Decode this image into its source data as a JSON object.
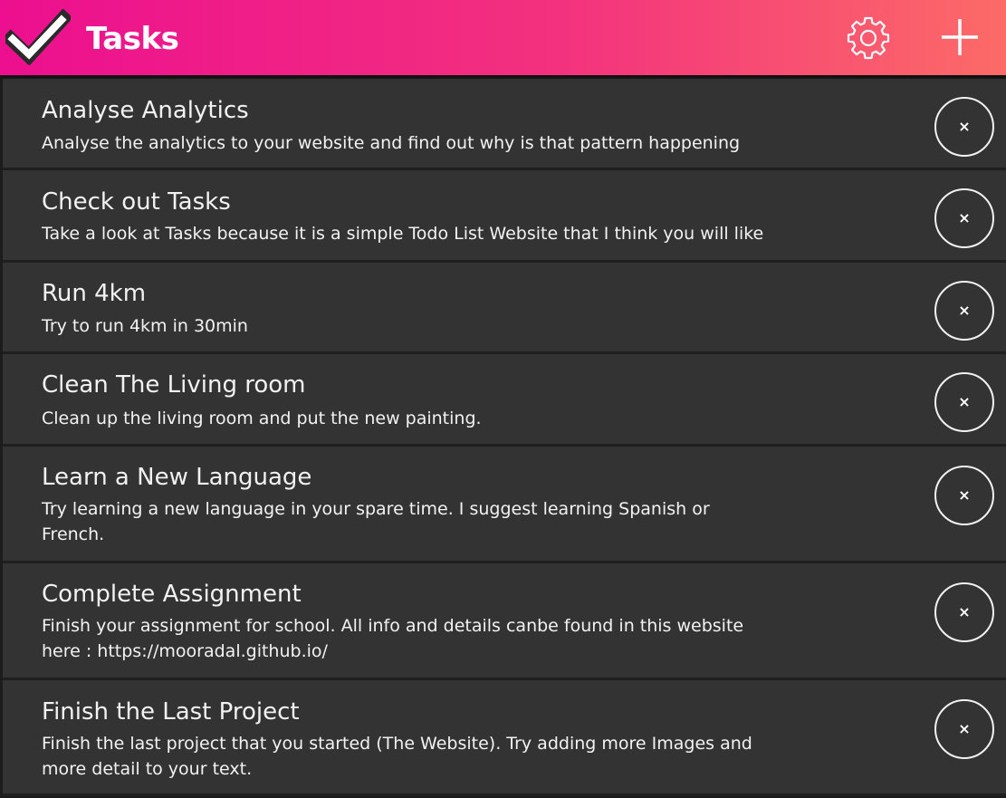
{
  "app": {
    "title": "Tasks",
    "logo_icon": "checkmark-icon",
    "settings_icon": "gear-icon",
    "add_icon": "plus-icon",
    "accent_gradient": [
      "#ec0f8f",
      "#fc6b67"
    ]
  },
  "tasks": [
    {
      "title": "Analyse Analytics",
      "description": "Analyse the analytics to your website and find out why is that pattern happening",
      "delete_label": "×"
    },
    {
      "title": "Check out Tasks",
      "description": "Take a look at Tasks because it is a simple Todo List Website that I think you will like",
      "delete_label": "×"
    },
    {
      "title": "Run 4km",
      "description": "Try to run 4km in 30min",
      "delete_label": "×"
    },
    {
      "title": "Clean The Living room",
      "description": "Clean up the living room and put the new painting.",
      "delete_label": "×"
    },
    {
      "title": "Learn a New Language",
      "description": "Try learning a new language in your spare time. I suggest learning Spanish or French.",
      "delete_label": "×"
    },
    {
      "title": "Complete Assignment",
      "description": "Finish your assignment for school. All info and details canbe found in this website here : https://mooradal.github.io/",
      "delete_label": "×"
    },
    {
      "title": "Finish the Last Project",
      "description": "Finish the last project that you started (The Website). Try adding more Images and more detail to your text.",
      "delete_label": "×"
    }
  ]
}
